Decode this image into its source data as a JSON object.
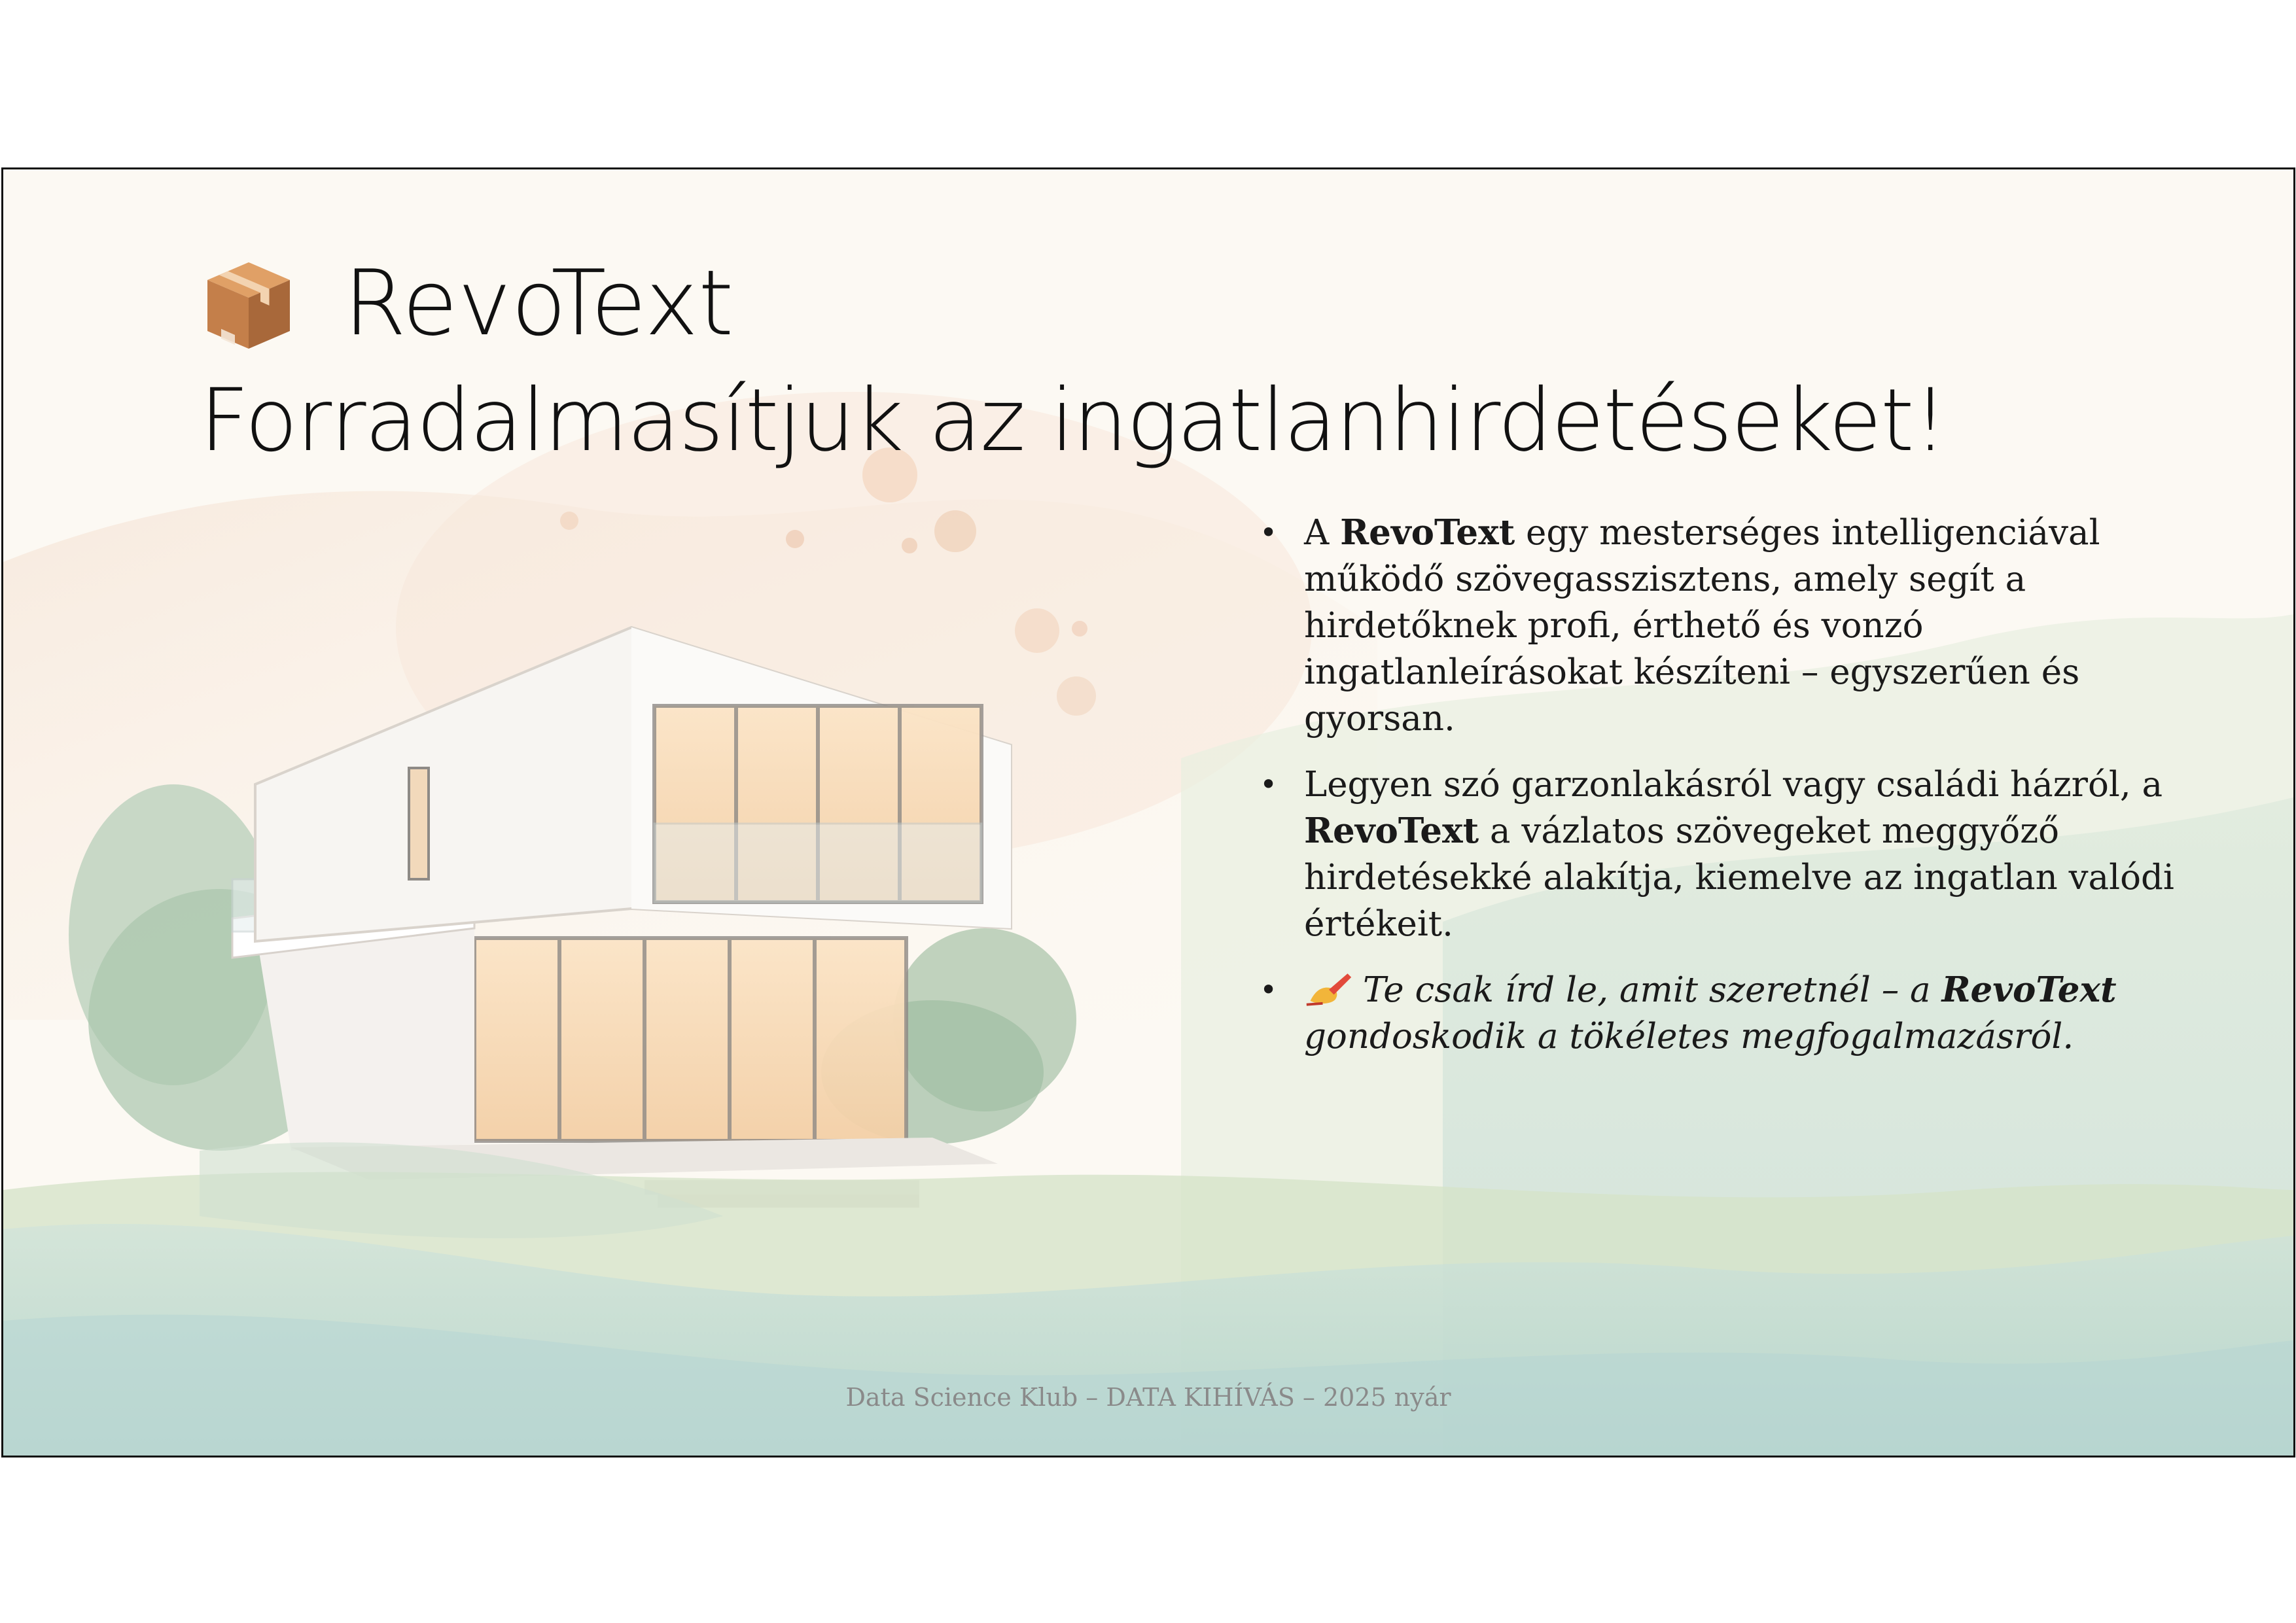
{
  "slide": {
    "title_line1": "RevoText",
    "title_line2": "Forradalmasítjuk az ingatlanhirdetéseket!",
    "icons": {
      "title": "package-box-icon",
      "pen": "writing-hand-icon"
    },
    "bullets": [
      {
        "b1_pre": "A ",
        "b1_bold": "RevoText",
        "b1_post": " egy mesterséges intelligenciával működő szövegasszisztens, amely segít a hirdetőknek profi, érthető és vonzó ingatlanleírásokat készíteni – egyszerűen és gyorsan."
      },
      {
        "b2_pre": "Legyen szó garzonlakásról vagy családi házról, a ",
        "b2_bold": "RevoText",
        "b2_post": " a vázlatos szövegeket meggyőző hirdetésekké alakítja, kiemelve az ingatlan valódi értékeit."
      },
      {
        "b3_pre": "Te csak írd le, amit szeretnél – a ",
        "b3_bold": "RevoText",
        "b3_post": " gondoskodik a tökéletes megfogalmazásról."
      }
    ],
    "footer": "Data Science Klub – DATA KIHÍVÁS – 2025 nyár"
  },
  "colors": {
    "title": "#111111",
    "body": "#1a1a1a",
    "footer": "#8a8a8a",
    "background": "#fcf9f3"
  }
}
